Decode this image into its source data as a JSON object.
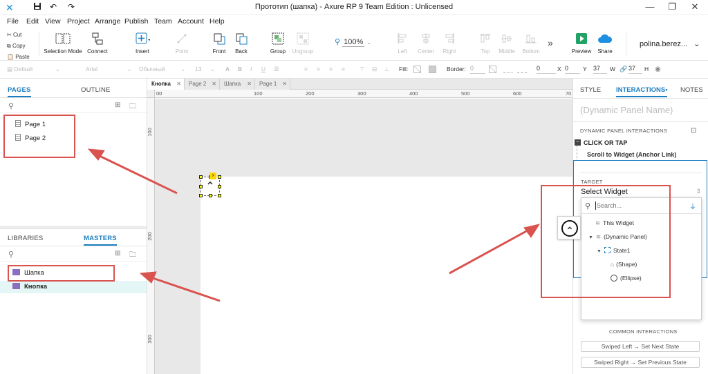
{
  "window": {
    "title": "Прототип (шапка) - Axure RP 9 Team Edition : Unlicensed"
  },
  "menu": [
    "File",
    "Edit",
    "View",
    "Project",
    "Arrange",
    "Publish",
    "Team",
    "Account",
    "Help"
  ],
  "clipboard": {
    "cut": "Cut",
    "copy": "Copy",
    "paste": "Paste"
  },
  "toolbar": {
    "selection_mode": "Selection Mode",
    "connect": "Connect",
    "insert": "Insert",
    "point": "Point",
    "front": "Front",
    "back": "Back",
    "group": "Group",
    "ungroup": "Ungroup",
    "zoom": "100%",
    "left": "Left",
    "center": "Center",
    "right": "Right",
    "top": "Top",
    "middle": "Middle",
    "bottom": "Bottom",
    "more": "»",
    "preview": "Preview",
    "share": "Share",
    "user": "polina.berez..."
  },
  "format": {
    "style": "Default",
    "font": "Arial",
    "weight": "Обычный",
    "size": "13",
    "fill_label": "Fill:",
    "border_label": "Border:",
    "border_value": "0",
    "x_value": "0",
    "x_label": "X",
    "y_value": "0",
    "y_label": "Y",
    "w_value": "37",
    "w_label": "W",
    "h_value": "37",
    "h_label": "H"
  },
  "pages_panel": {
    "tab_pages": "PAGES",
    "tab_outline": "OUTLINE",
    "pages": [
      "Page 1",
      "Page 2"
    ]
  },
  "masters_panel": {
    "tab_libraries": "LIBRARIES",
    "tab_masters": "MASTERS",
    "masters": [
      "Шапка",
      "Кнопка"
    ]
  },
  "doc_tabs": [
    "Кнопка",
    "Page 2",
    "Шапка",
    "Page 1"
  ],
  "ruler_h": [
    "00",
    "100",
    "200",
    "300",
    "400",
    "500",
    "600",
    "70"
  ],
  "ruler_v": [
    "100",
    "200",
    "300"
  ],
  "right_panel": {
    "tab_style": "STYLE",
    "tab_interactions": "INTERACTIONS",
    "tab_notes": "NOTES",
    "widget_name_placeholder": "(Dynamic Panel Name)",
    "section_title": "DYNAMIC PANEL INTERACTIONS",
    "event": "CLICK OR TAP",
    "action": "Scroll to Widget (Anchor Link)",
    "target_label": "TARGET",
    "target_select": "Select Widget",
    "common_title": "COMMON INTERACTIONS",
    "common_buttons": [
      "Swiped Left → Set Next State",
      "Swiped Right → Set Previous State"
    ]
  },
  "dropdown": {
    "search_placeholder": "Search...",
    "items": [
      "This Widget",
      "(Dynamic Panel)",
      "State1",
      "(Shape)",
      "(Ellipse)"
    ]
  },
  "colors": {
    "accent": "#1b7ec2",
    "annotation_red": "#d9534f",
    "canvas_gray": "#e8e8e8",
    "preview_green": "#21a366",
    "share_blue": "#1e8fe1",
    "master_purple": "#8a6fc1"
  }
}
